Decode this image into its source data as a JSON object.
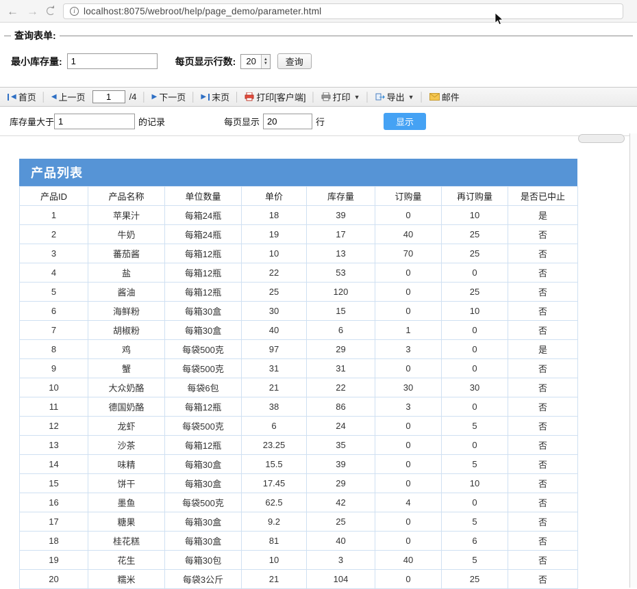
{
  "browser": {
    "url": "localhost:8075/webroot/help/page_demo/parameter.html"
  },
  "query_form": {
    "legend": "查询表单:",
    "min_stock_label": "最小库存量:",
    "min_stock_value": "1",
    "rows_per_page_label": "每页显示行数:",
    "rows_per_page_value": "20",
    "query_button": "查询"
  },
  "pager": {
    "first": "首页",
    "prev": "上一页",
    "page_value": "1",
    "page_total": "/4",
    "next": "下一页",
    "last": "末页",
    "print_client": "打印[客户端]",
    "print": "打印",
    "export": "导出",
    "mail": "邮件"
  },
  "filter": {
    "stock_gt_label": "库存量大于",
    "stock_gt_value": "1",
    "records_suffix": "的记录",
    "per_page_label": "每页显示",
    "per_page_value": "20",
    "rows_suffix": "行",
    "show_button": "显示"
  },
  "table": {
    "title": "产品列表",
    "headers": [
      "产品ID",
      "产品名称",
      "单位数量",
      "单价",
      "库存量",
      "订购量",
      "再订购量",
      "是否已中止"
    ],
    "rows": [
      [
        "1",
        "苹果汁",
        "每箱24瓶",
        "18",
        "39",
        "0",
        "10",
        "是"
      ],
      [
        "2",
        "牛奶",
        "每箱24瓶",
        "19",
        "17",
        "40",
        "25",
        "否"
      ],
      [
        "3",
        "蕃茄酱",
        "每箱12瓶",
        "10",
        "13",
        "70",
        "25",
        "否"
      ],
      [
        "4",
        "盐",
        "每箱12瓶",
        "22",
        "53",
        "0",
        "0",
        "否"
      ],
      [
        "5",
        "酱油",
        "每箱12瓶",
        "25",
        "120",
        "0",
        "25",
        "否"
      ],
      [
        "6",
        "海鲜粉",
        "每箱30盒",
        "30",
        "15",
        "0",
        "10",
        "否"
      ],
      [
        "7",
        "胡椒粉",
        "每箱30盒",
        "40",
        "6",
        "1",
        "0",
        "否"
      ],
      [
        "8",
        "鸡",
        "每袋500克",
        "97",
        "29",
        "3",
        "0",
        "是"
      ],
      [
        "9",
        "蟹",
        "每袋500克",
        "31",
        "31",
        "0",
        "0",
        "否"
      ],
      [
        "10",
        "大众奶酪",
        "每袋6包",
        "21",
        "22",
        "30",
        "30",
        "否"
      ],
      [
        "11",
        "德国奶酪",
        "每箱12瓶",
        "38",
        "86",
        "3",
        "0",
        "否"
      ],
      [
        "12",
        "龙虾",
        "每袋500克",
        "6",
        "24",
        "0",
        "5",
        "否"
      ],
      [
        "13",
        "沙茶",
        "每箱12瓶",
        "23.25",
        "35",
        "0",
        "0",
        "否"
      ],
      [
        "14",
        "味精",
        "每箱30盒",
        "15.5",
        "39",
        "0",
        "5",
        "否"
      ],
      [
        "15",
        "饼干",
        "每箱30盒",
        "17.45",
        "29",
        "0",
        "10",
        "否"
      ],
      [
        "16",
        "墨鱼",
        "每袋500克",
        "62.5",
        "42",
        "4",
        "0",
        "否"
      ],
      [
        "17",
        "糖果",
        "每箱30盒",
        "9.2",
        "25",
        "0",
        "5",
        "否"
      ],
      [
        "18",
        "桂花糕",
        "每箱30盒",
        "81",
        "40",
        "0",
        "6",
        "否"
      ],
      [
        "19",
        "花生",
        "每箱30包",
        "10",
        "3",
        "40",
        "5",
        "否"
      ],
      [
        "20",
        "糯米",
        "每袋3公斤",
        "21",
        "104",
        "0",
        "25",
        "否"
      ]
    ]
  },
  "colors": {
    "table_header_bg": "#5694d6",
    "table_border": "#cfe0f2",
    "show_button_bg": "#45a2f4",
    "pager_icon_blue": "#2e6fc4"
  }
}
